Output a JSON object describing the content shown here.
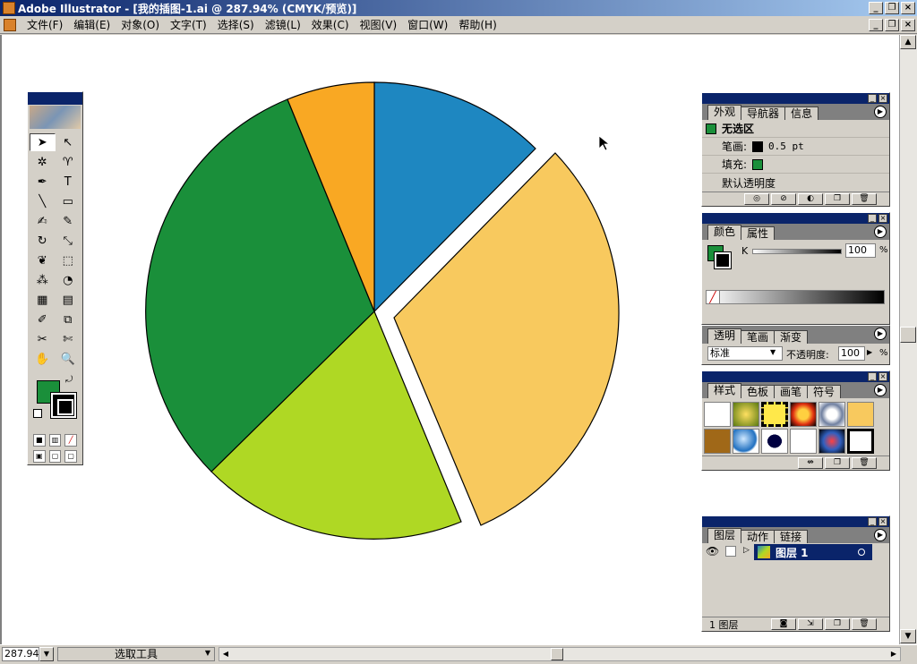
{
  "window": {
    "title": "Adobe Illustrator - [我的插图-1.ai @ 287.94% (CMYK/预览)]"
  },
  "menu": [
    "文件(F)",
    "编辑(E)",
    "对象(O)",
    "文字(T)",
    "选择(S)",
    "滤镜(L)",
    "效果(C)",
    "视图(V)",
    "窗口(W)",
    "帮助(H)"
  ],
  "colors": {
    "fill": "#1a8f3a",
    "slice_blue": "#1e87c1",
    "slice_yellow": "#f8c95e",
    "slice_lime": "#afd824",
    "slice_green": "#1a8f3a",
    "slice_orange": "#f9a823"
  },
  "appearance_panel": {
    "tabs": [
      "外观",
      "导航器",
      "信息"
    ],
    "header": "无选区",
    "stroke_label": "笔画:",
    "stroke_value": "0.5 pt",
    "fill_label": "填充:",
    "opacity_label": "默认透明度"
  },
  "color_panel": {
    "tabs": [
      "颜色",
      "属性"
    ],
    "channel": "K",
    "value": "100",
    "unit": "%"
  },
  "transparency_panel": {
    "tabs": [
      "透明",
      "笔画",
      "渐变"
    ],
    "blend_mode": "标准",
    "opacity_label": "不透明度:",
    "opacity_value": "100",
    "unit": "%"
  },
  "styles_panel": {
    "tabs": [
      "样式",
      "色板",
      "画笔",
      "符号"
    ]
  },
  "layers_panel": {
    "tabs": [
      "图层",
      "动作",
      "链接"
    ],
    "layer_name": "图层  1",
    "footer": "1 图层"
  },
  "status": {
    "zoom": "287.94%",
    "tool": "选取工具"
  }
}
